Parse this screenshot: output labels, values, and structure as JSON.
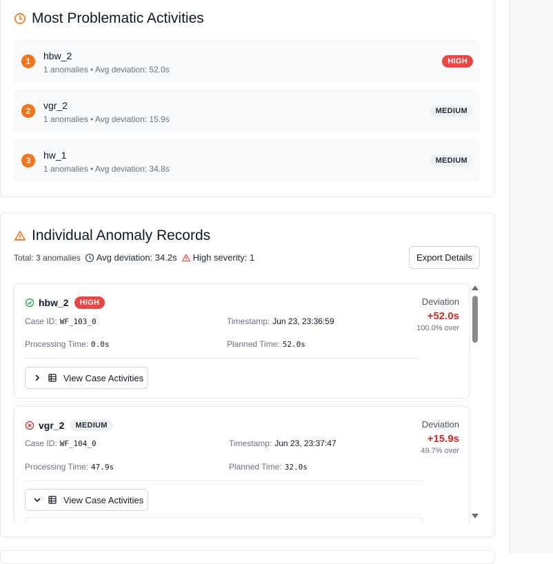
{
  "colors": {
    "accent": "#f97316",
    "high": "#ef4444",
    "deviation": "#dc2626",
    "success": "#16a34a"
  },
  "problematic": {
    "title": "Most Problematic Activities",
    "icon": "clock-icon",
    "items": [
      {
        "rank": "1",
        "name": "hbw_2",
        "meta": "1 anomalies • Avg deviation: 52.0s",
        "severity": "HIGH"
      },
      {
        "rank": "2",
        "name": "vgr_2",
        "meta": "1 anomalies • Avg deviation: 15.9s",
        "severity": "MEDIUM"
      },
      {
        "rank": "3",
        "name": "hw_1",
        "meta": "1 anomalies • Avg deviation: 34.8s",
        "severity": "MEDIUM"
      }
    ]
  },
  "records": {
    "title": "Individual Anomaly Records",
    "icon": "warning-triangle-icon",
    "summary": {
      "total": "Total: 3 anomalies",
      "avg": "Avg deviation: 34.2s",
      "high": "High severity: 1"
    },
    "export_label": "Export Details",
    "items": [
      {
        "name": "hbw_2",
        "status_icon": "check-circle-icon",
        "severity": "HIGH",
        "case_id_label": "Case ID:",
        "case_id": "WF_103_0",
        "timestamp_label": "Timestamp:",
        "timestamp": "Jun 23, 23:36:59",
        "processing_label": "Processing Time:",
        "processing": "0.0s",
        "planned_label": "Planned Time:",
        "planned": "52.0s",
        "deviation_label": "Deviation",
        "deviation": "+52.0s",
        "deviation_pct": "100.0% over",
        "view_label": "View Case Activities",
        "expanded": false
      },
      {
        "name": "vgr_2",
        "status_icon": "x-circle-icon",
        "severity": "MEDIUM",
        "case_id_label": "Case ID:",
        "case_id": "WF_104_0",
        "timestamp_label": "Timestamp:",
        "timestamp": "Jun 23, 23:37:47",
        "processing_label": "Processing Time:",
        "processing": "47.9s",
        "planned_label": "Planned Time:",
        "planned": "32.0s",
        "deviation_label": "Deviation",
        "deviation": "+15.9s",
        "deviation_pct": "49.7% over",
        "view_label": "View Case Activities",
        "expanded": true
      }
    ]
  }
}
